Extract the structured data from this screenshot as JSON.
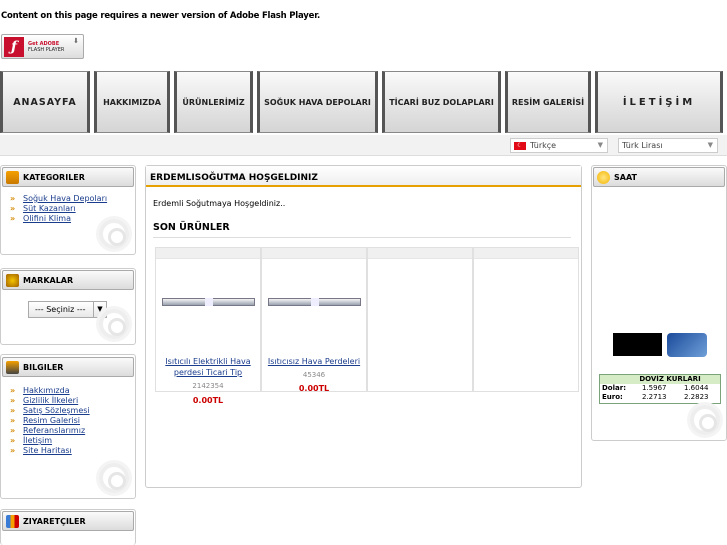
{
  "flash": {
    "message": "Content on this page requires a newer version of Adobe Flash Player.",
    "button_line1": "Get ADOBE",
    "button_line2": "FLASH PLAYER"
  },
  "menu": [
    {
      "label": "ANASAYFA"
    },
    {
      "label": "HAKKIMIZDA"
    },
    {
      "label": "ÜRÜNLERİMİZ"
    },
    {
      "label": "SOĞUK HAVA DEPOLARI"
    },
    {
      "label": "TİCARİ BUZ DOLAPLARI"
    },
    {
      "label": "RESİM GALERİSİ"
    },
    {
      "label": "İLETİŞİM"
    }
  ],
  "selectors": {
    "language": "Türkçe",
    "currency": "Türk Lirası"
  },
  "kategoriler": {
    "title": "KATEGORILER",
    "items": [
      "Soğuk Hava Depoları",
      "Süt Kazanları",
      "Olifini Klima"
    ]
  },
  "markalar": {
    "title": "MARKALAR",
    "select": "--- Seçiniz ---"
  },
  "bilgiler": {
    "title": "BILGILER",
    "items": [
      "Hakkımızda",
      "Gizlilik İlkeleri",
      "Satış Sözleşmesi",
      "Resim Galerisi",
      "Referanslarımız",
      "İletişim",
      "Site Haritası"
    ]
  },
  "ziyaretciler": {
    "title": "ZIYARETÇILER"
  },
  "main": {
    "title": "ERDEMLISOĞUTMA HOŞGELDINIZ",
    "welcome": "Erdemli Soğutmaya Hoşgeldiniz..",
    "section": "SON ÜRÜNLER",
    "products": [
      {
        "name": "Isıtıcılı Elektrikli Hava perdesi Ticari Tip",
        "code": "2142354",
        "price": "0.00TL"
      },
      {
        "name": "Isıtıcısız Hava Perdeleri",
        "code": "45346",
        "price": "0.00TL"
      }
    ]
  },
  "saat": {
    "title": "SAAT"
  },
  "doviz": {
    "title": "DÖVİZ KURLARI",
    "rows": [
      {
        "name": "Dolar:",
        "buy": "1.5967",
        "sell": "1.6044"
      },
      {
        "name": "Euro:",
        "buy": "2.2713",
        "sell": "2.2823"
      }
    ]
  }
}
